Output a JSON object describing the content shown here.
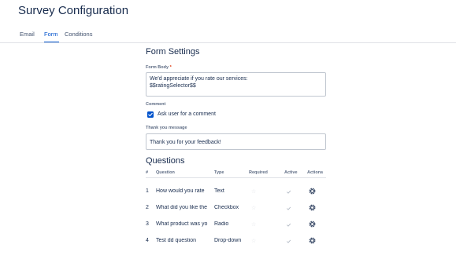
{
  "page_title": "Survey Configuration",
  "tabs": [
    {
      "label": "Email",
      "active": false
    },
    {
      "label": "Form",
      "active": true
    },
    {
      "label": "Conditions",
      "active": false
    }
  ],
  "form_settings": {
    "title": "Form Settings",
    "form_body_label": "Form Body",
    "required_marker": "*",
    "form_body_value_line1": "We'd appreciate if you rate our services:",
    "form_body_value_line2": "$$ratingSelector$$",
    "comment_label": "Comment",
    "comment_checkbox_label": "Ask user for a comment",
    "comment_checked": true,
    "thank_you_label": "Thank you message",
    "thank_you_value": "Thank you for your feedback!"
  },
  "questions": {
    "title": "Questions",
    "columns": {
      "num": "#",
      "question": "Question",
      "type": "Type",
      "required": "Required",
      "active": "Active",
      "actions": "Actions"
    },
    "rows": [
      {
        "num": "1",
        "question": "How would you rate",
        "type": "Text",
        "required": false,
        "active": true
      },
      {
        "num": "2",
        "question": "What did you like the",
        "type": "Checkbox",
        "required": false,
        "active": true
      },
      {
        "num": "3",
        "question": "What product was yo",
        "type": "Radio",
        "required": false,
        "active": true
      },
      {
        "num": "4",
        "question": "Test dd question",
        "type": "Drop-down",
        "required": false,
        "active": true
      }
    ]
  },
  "icons": {
    "checkbox": "checkmark-icon",
    "required": "star-icon",
    "active": "check-icon",
    "actions": "gear-icon"
  },
  "colors": {
    "accent": "#0052cc",
    "text": "#172b4d",
    "muted": "#5e6c84",
    "border": "#c1c7d0"
  }
}
